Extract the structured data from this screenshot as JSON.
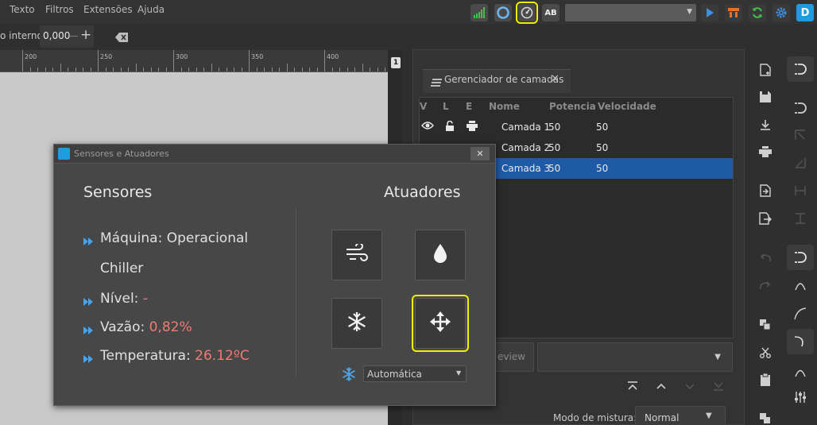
{
  "menubar": {
    "items": [
      "Texto",
      "Filtros",
      "Extensões",
      "Ajuda"
    ]
  },
  "toolbar": {
    "text_tool_label": "AB",
    "combo_value": ""
  },
  "spacing": {
    "label": "o interno:",
    "value": "0,000"
  },
  "ruler": {
    "labels": [
      "200",
      "250",
      "300",
      "350",
      "400"
    ]
  },
  "scroll_badge": "1",
  "layers_panel": {
    "tab_label": "Gerenciador de camadas",
    "columns": [
      "V",
      "L",
      "E",
      "Nome",
      "Potencia",
      "Velocidade"
    ],
    "rows": [
      {
        "name": "Camada 1",
        "potencia": "50",
        "velocidade": "50"
      },
      {
        "name": "Camada 2",
        "potencia": "50",
        "velocidade": "50"
      },
      {
        "name": "Camada 3",
        "potencia": "50",
        "velocidade": "50"
      }
    ],
    "preview_label": "eview",
    "blend_label": "Modo de mistura:",
    "blend_value": "Normal"
  },
  "dialog": {
    "title": "Sensores e Atuadores",
    "close_label": "✕",
    "sensors_heading": "Sensores",
    "actuators_heading": "Atuadores",
    "sensors": [
      {
        "label": "Máquina: ",
        "value": "Operacional"
      },
      {
        "label": "Nível: ",
        "value": "-"
      },
      {
        "label": "Vazão: ",
        "value": "0,82%"
      },
      {
        "label": "Temperatura: ",
        "value": "26.12ºC"
      }
    ],
    "machine_continuation": "Chiller",
    "actuators": [
      "wind-icon",
      "water-drop-icon",
      "snowflake-icon",
      "move-arrows-icon"
    ],
    "mode_value": "Automática"
  },
  "colors": {
    "accent_blue": "#1f9be0",
    "selection_blue": "#1f5aa6",
    "value_red": "#f07b74",
    "highlight_yellow": "#f0f000"
  }
}
